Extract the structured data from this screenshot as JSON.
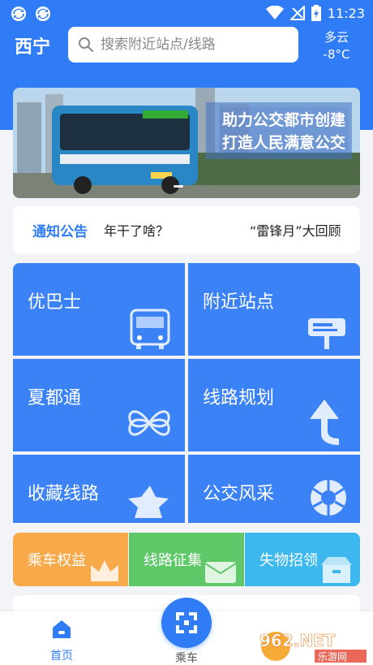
{
  "status_bar": {
    "time": "11:23"
  },
  "header": {
    "city": "西宁",
    "search_placeholder": "搜索附近站点/线路",
    "weather": {
      "condition": "多云",
      "temperature": "-8°C"
    }
  },
  "banner": {
    "line1": "助力公交都市创建",
    "line2": "打造人民满意公交"
  },
  "notice": {
    "label": "通知公告",
    "items": [
      "年干了啥？",
      "“雷锋月”大回顾"
    ]
  },
  "grid": {
    "tiles": [
      {
        "label": "优巴士",
        "icon": "bus-icon"
      },
      {
        "label": "附近站点",
        "icon": "bus-stop-sign-icon"
      },
      {
        "label": "夏都通",
        "icon": "knot-icon"
      },
      {
        "label": "线路规划",
        "icon": "route-arrow-icon"
      },
      {
        "label": "收藏线路",
        "icon": "star-icon"
      },
      {
        "label": "公交风采",
        "icon": "camera-aperture-icon"
      }
    ]
  },
  "quick_links": [
    {
      "label": "乘车权益",
      "color": "#f8a94a",
      "icon": "crown-icon"
    },
    {
      "label": "线路征集",
      "color": "#5fc96a",
      "icon": "envelope-icon"
    },
    {
      "label": "失物招领",
      "color": "#3cb8ef",
      "icon": "box-icon"
    }
  ],
  "bottom_nav": {
    "home": "首页",
    "ride": "乘车"
  },
  "watermark": {
    "brand": "962.NET",
    "subtitle": "乐游网"
  },
  "colors": {
    "primary": "#2f7cf6",
    "tile": "#3b82f6"
  }
}
